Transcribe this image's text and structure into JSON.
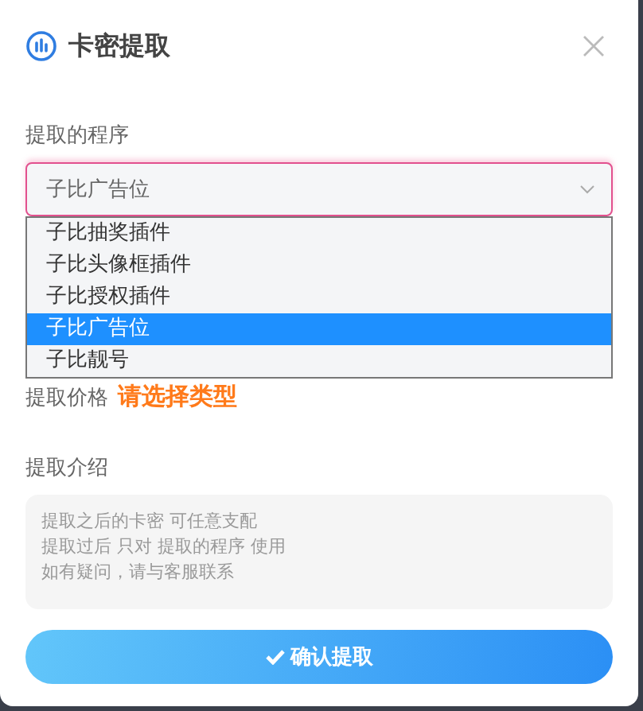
{
  "dialog": {
    "title": "卡密提取"
  },
  "program": {
    "label": "提取的程序",
    "value": "子比广告位",
    "options": [
      {
        "label": "子比抽奖插件",
        "selected": false
      },
      {
        "label": "子比头像框插件",
        "selected": false
      },
      {
        "label": "子比授权插件",
        "selected": false
      },
      {
        "label": "子比广告位",
        "selected": true
      },
      {
        "label": "子比靓号",
        "selected": false
      }
    ]
  },
  "price": {
    "label": "提取价格",
    "value": "请选择类型"
  },
  "intro": {
    "label": "提取介绍",
    "placeholder_lines": [
      "提取之后的卡密 可任意支配",
      "提取过后 只对 提取的程序 使用",
      "如有疑问，请与客服联系"
    ]
  },
  "confirm_button": "确认提取"
}
